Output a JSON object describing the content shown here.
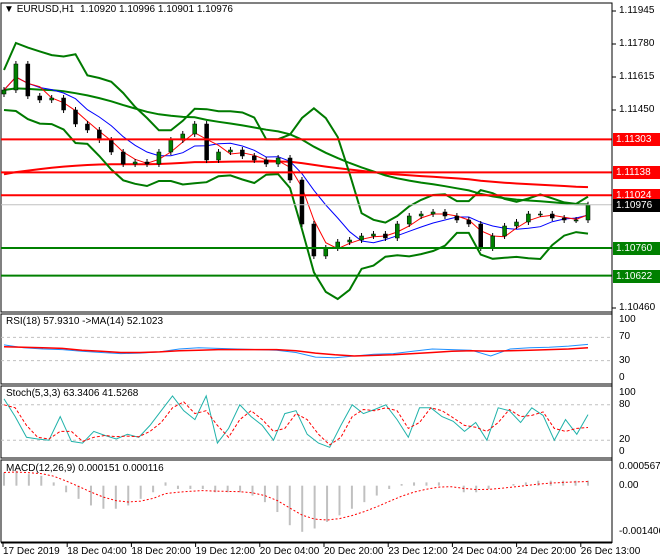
{
  "header": {
    "symbol": "EURUSD,H1",
    "ohlc": "1.10920 1.10996 1.10901 1.10976"
  },
  "rsi_label": "RSI(18) 57.9310  ->MA(14) 52.1023",
  "stoch_label": "Stoch(5,3,3) 63.3406 41.5268",
  "macd_label": "MACD(12,26,9) 0.000151 0.000116",
  "colors": {
    "up": "#008000",
    "down": "#000000",
    "bands": "#007a00",
    "resistance": "#ff0000",
    "support": "#008000",
    "rsi": "#1e90ff",
    "rsi_ma": "#ff0000",
    "stoch": "#20b2aa",
    "stoch_signal": "#ff0000",
    "macd_hist": "#c0c0c0",
    "macd_signal": "#ff0000"
  },
  "chart_data": [
    {
      "type": "candlestick",
      "symbol": "EURUSD",
      "timeframe": "H1",
      "y_ticks": [
        "1.11945",
        "1.11780",
        "1.11615",
        "1.11450",
        "1.10460"
      ],
      "ylim": [
        1.1046,
        1.1199
      ],
      "x_ticks": [
        "17 Dec 2019",
        "18 Dec 04:00",
        "18 Dec 20:00",
        "19 Dec 12:00",
        "20 Dec 04:00",
        "20 Dec 20:00",
        "23 Dec 12:00",
        "24 Dec 04:00",
        "24 Dec 20:00",
        "26 Dec 13:00"
      ],
      "levels": [
        {
          "value": "1.11303",
          "kind": "resistance"
        },
        {
          "value": "1.11138",
          "kind": "resistance"
        },
        {
          "value": "1.11024",
          "kind": "resistance"
        },
        {
          "value": "1.10760",
          "kind": "support"
        },
        {
          "value": "1.10622",
          "kind": "support"
        }
      ],
      "current_price": "1.10976",
      "closes": [
        1.1155,
        1.1168,
        1.1152,
        1.115,
        1.1151,
        1.1145,
        1.1138,
        1.1135,
        1.113,
        1.1124,
        1.1118,
        1.1119,
        1.1118,
        1.1124,
        1.113,
        1.1133,
        1.1138,
        1.112,
        1.1124,
        1.1125,
        1.1122,
        1.112,
        1.1118,
        1.1121,
        1.111,
        1.1088,
        1.1072,
        1.1076,
        1.1079,
        1.108,
        1.1082,
        1.1083,
        1.1081,
        1.1088,
        1.1092,
        1.1093,
        1.1094,
        1.1092,
        1.109,
        1.1088,
        1.1076,
        1.1082,
        1.1087,
        1.1089,
        1.1093,
        1.1093,
        1.1091,
        1.109,
        1.109,
        1.10976
      ]
    },
    {
      "type": "line",
      "name": "RSI(18)",
      "ylim": [
        0,
        100
      ],
      "y_ticks": [
        "100",
        "70",
        "30",
        "0"
      ],
      "values": [
        57,
        52,
        50,
        49,
        46,
        44,
        42,
        43,
        45,
        50,
        52,
        51,
        50,
        49,
        48,
        44,
        36,
        35,
        38,
        41,
        42,
        46,
        50,
        49,
        48,
        38,
        50,
        52,
        53,
        55,
        57.93
      ],
      "ma": [
        54,
        53,
        52,
        51,
        48,
        46,
        44,
        44,
        45,
        47,
        48,
        49,
        49,
        49,
        49,
        47,
        43,
        40,
        38,
        39,
        40,
        42,
        44,
        46,
        47,
        46,
        47,
        48,
        49,
        50,
        52.1
      ]
    },
    {
      "type": "line",
      "name": "Stoch(5,3,3)",
      "ylim": [
        0,
        100
      ],
      "y_ticks": [
        "100",
        "80",
        "20",
        "0"
      ],
      "k": [
        90,
        60,
        25,
        22,
        20,
        60,
        18,
        15,
        35,
        28,
        22,
        30,
        25,
        45,
        70,
        95,
        70,
        55,
        95,
        15,
        40,
        80,
        60,
        45,
        20,
        65,
        70,
        30,
        15,
        8,
        45,
        80,
        65,
        72,
        80,
        55,
        25,
        75,
        75,
        60,
        52,
        35,
        50,
        20,
        75,
        70,
        50,
        75,
        62,
        20,
        55,
        30,
        63.34
      ],
      "d": [
        80,
        75,
        45,
        25,
        22,
        35,
        35,
        18,
        25,
        28,
        26,
        27,
        26,
        35,
        50,
        75,
        85,
        65,
        70,
        45,
        25,
        55,
        70,
        55,
        35,
        40,
        65,
        55,
        30,
        12,
        25,
        60,
        72,
        70,
        75,
        70,
        40,
        50,
        75,
        70,
        58,
        45,
        42,
        35,
        50,
        72,
        60,
        62,
        68,
        40,
        35,
        40,
        41.53
      ]
    },
    {
      "type": "bar",
      "name": "MACD(12,26,9)",
      "ylim": [
        -0.001406,
        0.000567
      ],
      "y_ticks": [
        "0.000567",
        "0.00",
        "-0.001406"
      ],
      "hist": [
        0.0004,
        0.00045,
        0.00035,
        0.0003,
        0.0001,
        -0.0002,
        -0.0004,
        -0.0006,
        -0.0007,
        -0.0007,
        -0.0006,
        -0.0004,
        -0.0002,
        0.0001,
        -0.0001,
        -0.0001,
        -0.0001,
        -0.0002,
        -0.0002,
        -0.0002,
        -0.0003,
        -0.0005,
        -0.0008,
        -0.0012,
        -0.0014,
        -0.0013,
        -0.0011,
        -0.0009,
        -0.0007,
        -0.0005,
        -0.0003,
        -0.0001,
        5e-05,
        0.0001,
        0.0001,
        0.0001,
        0,
        -0.0002,
        -0.0002,
        -0.0001,
        0,
        5e-05,
        0.0001,
        0.00015,
        0.00015,
        0.00015,
        0.00015,
        0.000151
      ]
    }
  ]
}
